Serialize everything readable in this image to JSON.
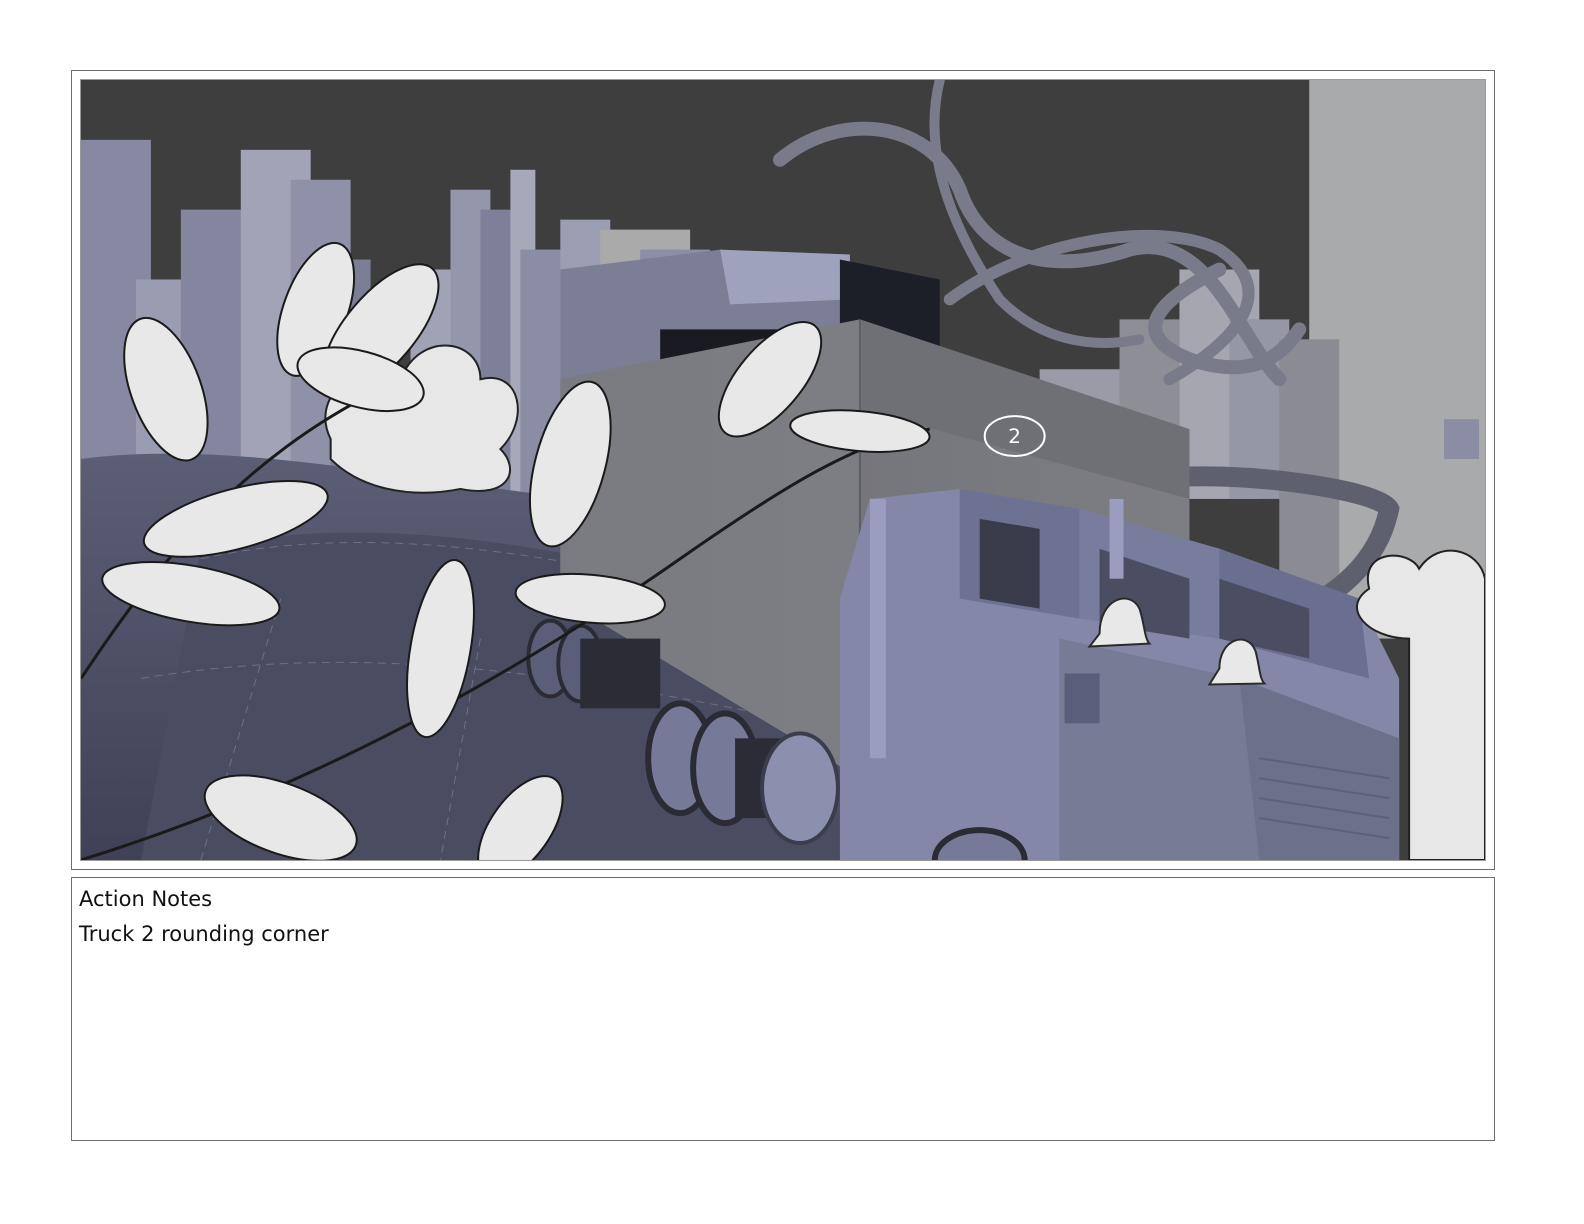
{
  "notes": {
    "heading": "Action Notes",
    "text": "Truck 2 rounding corner"
  },
  "panel": {
    "truck_label": "2"
  }
}
